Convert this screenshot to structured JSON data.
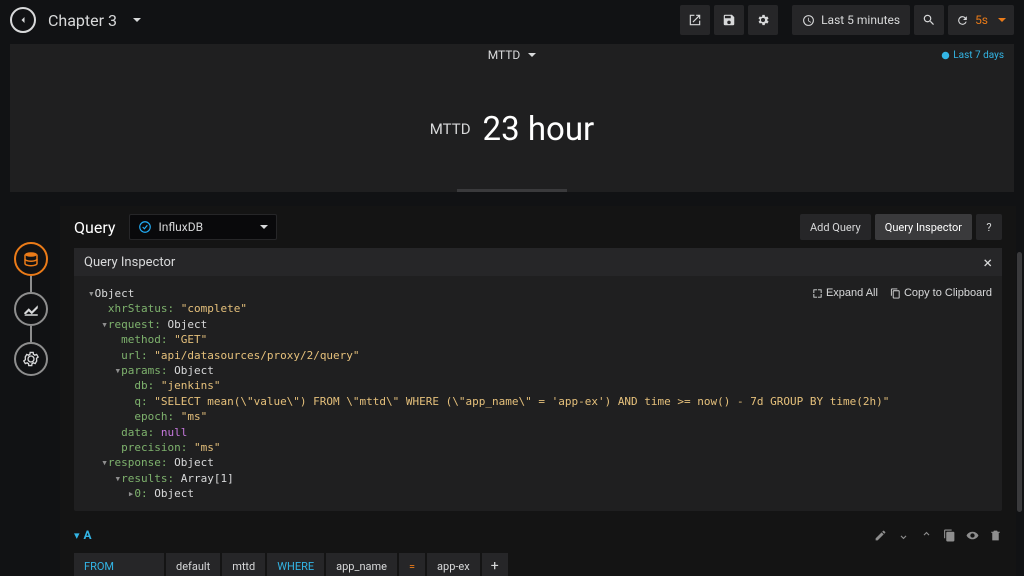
{
  "header": {
    "title": "Chapter 3",
    "timeRange": "Last 5 minutes",
    "refreshInterval": "5s"
  },
  "panel": {
    "title": "MTTD",
    "timeOverride": "Last 7 days",
    "statLabel": "MTTD",
    "statValue": "23 hour"
  },
  "editor": {
    "tabLabel": "Query",
    "datasource": "InfluxDB",
    "addQueryLabel": "Add Query",
    "inspectorBtnLabel": "Query Inspector",
    "helpLabel": "?"
  },
  "inspector": {
    "title": "Query Inspector",
    "expandAll": "Expand All",
    "copy": "Copy to Clipboard",
    "json": {
      "root": "Object",
      "xhrStatus_k": "xhrStatus:",
      "xhrStatus_v": "\"complete\"",
      "request_k": "request:",
      "request_v": "Object",
      "method_k": "method:",
      "method_v": "\"GET\"",
      "url_k": "url:",
      "url_v": "\"api/datasources/proxy/2/query\"",
      "params_k": "params:",
      "params_v": "Object",
      "db_k": "db:",
      "db_v": "\"jenkins\"",
      "q_k": "q:",
      "q_v": "\"SELECT mean(\\\"value\\\") FROM \\\"mttd\\\" WHERE (\\\"app_name\\\" = 'app-ex') AND time >= now() - 7d GROUP BY time(2h)\"",
      "epoch_k": "epoch:",
      "epoch_v": "\"ms\"",
      "data_k": "data:",
      "data_v": "null",
      "precision_k": "precision:",
      "precision_v": "\"ms\"",
      "response_k": "response:",
      "response_v": "Object",
      "results_k": "results:",
      "results_v": "Array[1]",
      "idx0_k": "0:",
      "idx0_v": "Object"
    }
  },
  "queryRow": {
    "letter": "A",
    "from": "FROM",
    "default": "default",
    "measurement": "mttd",
    "where": "WHERE",
    "tagKey": "app_name",
    "op": "=",
    "tagVal": "app-ex",
    "plus": "+"
  }
}
